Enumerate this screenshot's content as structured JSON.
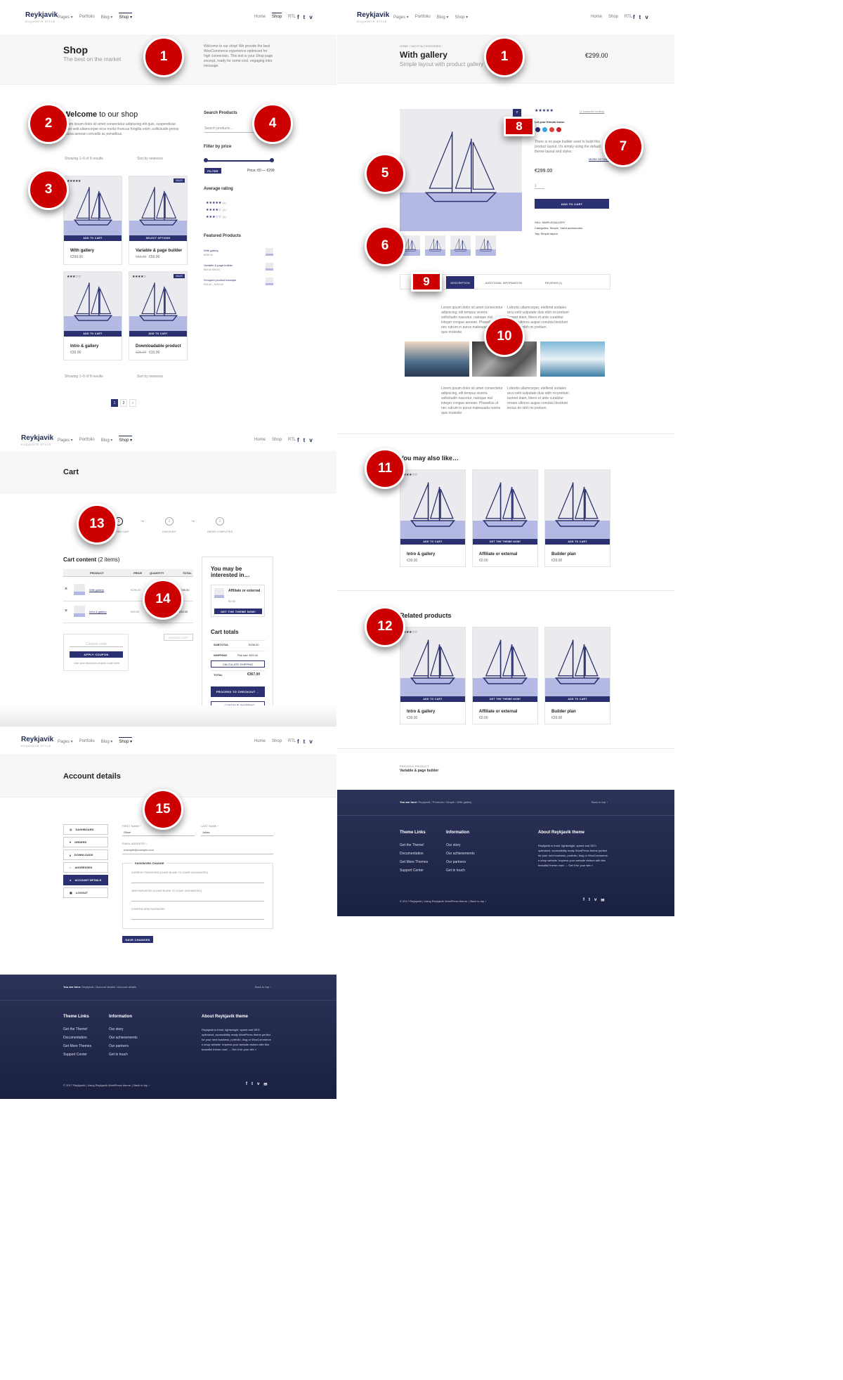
{
  "brand": {
    "name": "Reykjavik",
    "tagline": "EXQUISITE STYLE"
  },
  "nav": {
    "left_items": [
      "Pages ▾",
      "Portfolio",
      "Blog ▾",
      "Shop ▾"
    ],
    "right_items": [
      "Home",
      "Shop",
      "RTL"
    ],
    "social_icons": [
      "facebook-icon",
      "twitter-icon",
      "vimeo-icon"
    ]
  },
  "markers": [
    "1",
    "2",
    "3",
    "4",
    "5",
    "6",
    "7",
    "8",
    "9",
    "10",
    "11",
    "12",
    "13",
    "14",
    "15"
  ],
  "shop": {
    "title": "Shop",
    "subtitle": "The best on the market",
    "intro": "Welcome to our shop! We provide the best WooCommerce experience optimized for high conversion. This text is your Shop page excerpt, ready for some cool, engaging intro message.",
    "welcome_bold": "Welcome",
    "welcome_rest": " to our shop",
    "welcome_text": "Lorem ipsum dolor sit amet consectetur adipiscing elit quis, suspendisse etiam velit ullamcorper eros morbi rhoncus fringilla enim, sollicitudin primis massa aenean convallis ac penatibus.",
    "showing": "Showing 1–6 of 8 results",
    "sort": "Sort by newness",
    "products": [
      {
        "name": "With gallery",
        "price": "€299.00",
        "button": "ADD TO CART",
        "sale": ""
      },
      {
        "name": "Variable & page builder",
        "price": "€59.00",
        "old_price": "€69.00",
        "button": "SELECT OPTIONS",
        "sale": "SALE!"
      },
      {
        "name": "Intro & gallery",
        "price": "€39.00",
        "button": "ADD TO CART",
        "sale": ""
      },
      {
        "name": "Downloadable product",
        "price": "€15.00",
        "old_price": "€25.00",
        "button": "ADD TO CART",
        "sale": "SALE!"
      }
    ],
    "pages": [
      "1",
      "2",
      "›"
    ],
    "sidebar": {
      "search_title": "Search Products",
      "search_placeholder": "Search products…",
      "filter_title": "Filter by price",
      "filter_button": "FILTER",
      "price_range": "Price: €0 — €299",
      "rating_title": "Average rating",
      "ratings": [
        {
          "stars": "★★★★★",
          "count": "(1)"
        },
        {
          "stars": "★★★★☆",
          "count": "(1)"
        },
        {
          "stars": "★★★☆☆",
          "count": "(1)"
        }
      ],
      "featured_title": "Featured Products",
      "featured": [
        {
          "name": "With gallery",
          "price": "€299.00"
        },
        {
          "name": "Variable & page builder",
          "price": "€69.00 €59.00"
        },
        {
          "name": "Grouped product example",
          "price": "€39.00 – €299.00"
        }
      ]
    }
  },
  "product": {
    "breadcrumb": "HOME / YACHT ACCESSORIES /",
    "title": "With gallery",
    "subtitle": "Simple layout with product gallery",
    "price_header": "€299.00",
    "stars": "★★★★★",
    "reviews_link": "(1 customer review)",
    "share_label": "Let your friends know:",
    "description": "There is no page builder used to build this product layout. It's simply using the default theme layout and styles.",
    "more_details": "MORE DETAILS ›",
    "price": "€299.00",
    "qty": "1",
    "add_to_cart": "ADD TO CART",
    "sku": "SKU: SIMPLEGALLERY",
    "categories": "Categories: Simple, Yacht accessories",
    "tag": "Tag: Simple layout",
    "tabs": [
      "DESCRIPTION",
      "ADDITIONAL INFORMATION",
      "REVIEWS (1)"
    ],
    "lorem_a": "Lorem ipsum dolor sit amet consectetur adipiscing, elit tempus viverra sollicitudin nascetur, natoque nisl integer congue aenean. Phasellus ut nec rutrum in purus malesuada nostra quis molestie.",
    "lorem_b": "Lobortis ullamcorper, eleifend sodales arcu velit vulputate duis nibh mi pretium laoreet diam, libero et ante curabitur ornare ultrices augue conubia tincidunt lectus do nibh mi pretium."
  },
  "related": {
    "also_like": "You may also like…",
    "related_title": "Related products",
    "items": [
      {
        "name": "Intro & gallery",
        "price": "€39.00",
        "button": "ADD TO CART"
      },
      {
        "name": "Affiliate or external",
        "price": "€0.00",
        "button": "GET THE THEME NOW!"
      },
      {
        "name": "Builder plan",
        "price": "€29.00",
        "button": "ADD TO CART"
      }
    ],
    "prev_label": "PREVIOUS PRODUCT",
    "prev_name": "Variable & page builder"
  },
  "cart": {
    "title": "Cart",
    "steps": [
      {
        "n": "1",
        "label": "SHOPPING CART"
      },
      {
        "n": "2",
        "label": "CHECKOUT"
      },
      {
        "n": "3",
        "label": "ORDER COMPLETED"
      }
    ],
    "content_title": "Cart content",
    "content_count": "(2 items)",
    "headers": [
      "PRODUCT",
      "PRICE",
      "QUANTITY",
      "TOTAL"
    ],
    "rows": [
      {
        "name": "With gallery",
        "price": "€299.00",
        "total": "€299.00"
      },
      {
        "name": "Intro & gallery",
        "price": "€39.00",
        "total": "€39.00"
      }
    ],
    "update_cart": "UPDATE CART",
    "coupon_placeholder": "Coupon code",
    "apply_coupon": "APPLY COUPON",
    "coupon_note": "Use your discount coupon code here",
    "interested_title": "You may be interested in…",
    "interested_item": "Affiliate or external",
    "interested_price": "€0.00",
    "interested_button": "GET THE THEME NOW!",
    "totals_title": "Cart totals",
    "subtotal_label": "SUBTOTAL",
    "subtotal": "€338.00",
    "shipping_label": "SHIPPING",
    "shipping": "Flat rate: €29.00",
    "calc_shipping": "CALCULATE SHIPPING",
    "total_label": "TOTAL",
    "total": "€367.00",
    "checkout": "PROCEED TO CHECKOUT →",
    "continue": "← CONTINUE SHOPPING"
  },
  "account": {
    "title": "Account details",
    "menu": [
      "DASHBOARD",
      "ORDERS",
      "DOWNLOADS",
      "ADDRESSES",
      "ACCOUNT DETAILS",
      "LOGOUT"
    ],
    "first_name_label": "FIRST NAME *",
    "first_name": "Oliver",
    "last_name_label": "LAST NAME *",
    "last_name": "Jultas",
    "email_label": "EMAIL ADDRESS *",
    "email": "example@example.com",
    "password_legend": "PASSWORD CHANGE",
    "pw_current": "CURRENT PASSWORD (LEAVE BLANK TO LEAVE UNCHANGED)",
    "pw_new": "NEW PASSWORD (LEAVE BLANK TO LEAVE UNCHANGED)",
    "pw_confirm": "CONFIRM NEW PASSWORD",
    "save": "SAVE CHANGES"
  },
  "footer": {
    "you_are_here": "You are here:",
    "crumbs_product": "Reykjavik / Products / Simple / With gallery",
    "crumbs_account": "Reykjavik / Account details / Account details",
    "back_top": "Back to top ↑",
    "theme_links_title": "Theme Links",
    "theme_links": [
      "Get the Theme!",
      "Documentation",
      "Get More Themes",
      "Support Center"
    ],
    "info_title": "Information",
    "info_links": [
      "Our story",
      "Our achievements",
      "Our partners",
      "Get in touch"
    ],
    "about_title": "About Reykjavik theme",
    "about_text": "Reykjavik is fresh, lightweight, speed and SEO optimized, accessibility ready WordPress theme perfect for your next business, portfolio, blog or WooCommerce e-shop website. Impress your website visitors with this beautiful theme now! → Get it for your site »",
    "copyright": "© 2017 Reykjavik | Using Reykjavik WordPress theme. | Back to top ↑"
  }
}
